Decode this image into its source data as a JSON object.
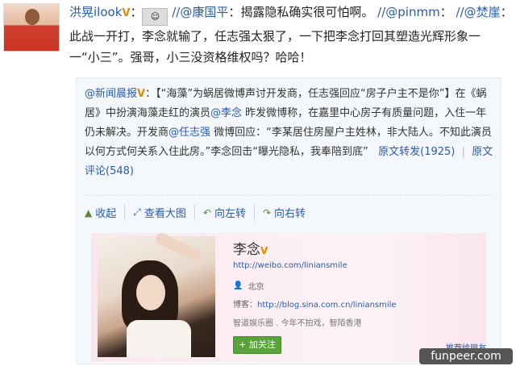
{
  "post": {
    "author": "洪晃ilook",
    "author_badge": "V",
    "emoji_icon": "emoticon-icon",
    "forward1_user": "//@康国平",
    "forward1_text": "：揭露隐私确实很可怕啊。",
    "forward2_user": "//@pinmm",
    "forward2_sep": "：",
    "forward3_user": "//@焚崖",
    "forward3_sep": "：",
    "body_line1": "此战一开打，李念就输了，任志强太狠了，一下把李念打回其塑造光辉形象一",
    "body_line2": "一“小三”。强哥，小三没资格维权吗？哈哈！"
  },
  "quote": {
    "source_user": "@新闻晨报",
    "source_badge": "V",
    "text_part1": "：【“海藻”为蜗居微博声讨开发商，任志强回应“房子户主不是你”】在《蜗居》中扮演海藻走红的演员",
    "mention1": "@李念",
    "text_part2": " 昨发微博称，在嘉里中心房子有质量问题，入住一年仍未解决。开发商",
    "mention2": "@任志强",
    "text_part3": " 微博回应：“李某居住房屋户主姓林，非大陆人。不知此演员以何方式何关系入住此房。”李念回击“曝光隐私，我奉陪到底”",
    "repost_label": "原文转发(1925)",
    "separator": "|",
    "comment_label": "原文评论(548)"
  },
  "actions": {
    "collapse": "收起",
    "view_large": "查看大图",
    "rotate_left": "向左转",
    "rotate_right": "向右转"
  },
  "card": {
    "name": "李念",
    "badge": "V",
    "weibo_url": "http://weibo.com/liniansmile",
    "location": "北京",
    "blog_label": "博客：",
    "blog_url": "http://blog.sina.com.cn/liniansmile",
    "description": "智道娱乐圈 . 今年不拍戏，智陌香港",
    "follow_label": "+ 加关注",
    "recommend_label": "推荐给朋友"
  },
  "watermark": "funpeer.com"
}
